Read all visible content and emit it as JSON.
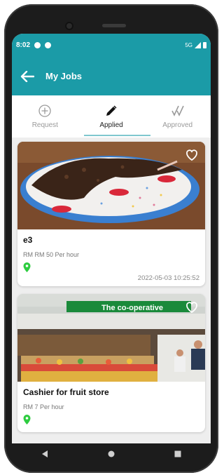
{
  "status_bar": {
    "time": "8:02",
    "network": "5G"
  },
  "app_bar": {
    "title": "My Jobs"
  },
  "tabs": [
    {
      "label": "Request",
      "icon": "plus-circle-icon",
      "active": false
    },
    {
      "label": "Applied",
      "icon": "pencil-icon",
      "active": true
    },
    {
      "label": "Approved",
      "icon": "double-check-icon",
      "active": false
    }
  ],
  "jobs": [
    {
      "title": "e3",
      "rate": "RM RM 50 Per hour",
      "date": "2022-05-03 10:25:52",
      "image": "cake-photo"
    },
    {
      "title": "Cashier for fruit store",
      "rate": "RM 7 Per hour",
      "date": "",
      "image": "fruit-store-photo",
      "store_sign": "The co-operative"
    }
  ],
  "colors": {
    "primary": "#1b9ba7",
    "pin": "#2ecc40",
    "indicator": "#7fc7cf"
  }
}
